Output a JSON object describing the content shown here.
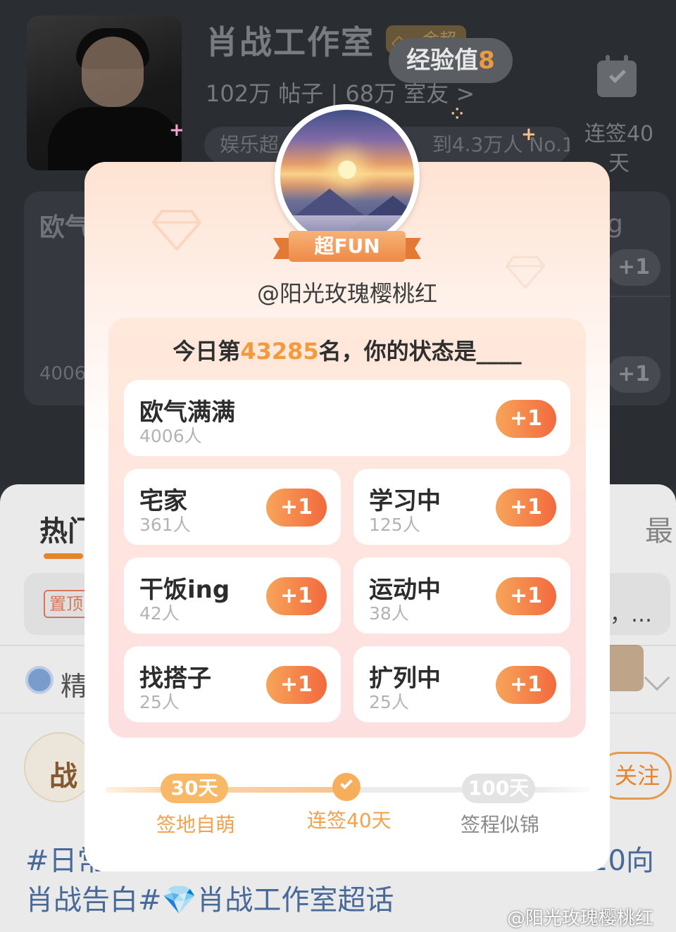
{
  "background": {
    "group_name": "肖战工作室",
    "level_badge": "金超",
    "stats_text": "102万 帖子 | 68万 室友 >",
    "rank_pill_left": "娱乐超",
    "rank_pill_right": "到4.3万人 No.1",
    "exp_label": "经验值",
    "exp_value": "8",
    "streak_label": "连签40天",
    "status_bg_label": "欧气",
    "status_bg_count": "4006",
    "status_bg_suffix": "g",
    "plus_label": "+1",
    "tab_hot": "热门",
    "tab_latest": "最",
    "pin_tag": "置顶",
    "pin_more": "，…",
    "featured_label": "精",
    "post_avatar_text": "战",
    "follow_button": "关注",
    "post_line1_left": "#日常",
    "post_line1_right": "20向",
    "post_line2": "肖战告白#💎肖战工作室超话"
  },
  "modal": {
    "badge": "超FUN",
    "username": "@阳光玫瑰樱桃红",
    "rank_prefix": "今日第",
    "rank_number": "43285",
    "rank_suffix": "名，你的状态是____",
    "options": [
      {
        "label": "欧气满满",
        "count": "4006人",
        "button": "+1"
      },
      {
        "label": "宅家",
        "count": "361人",
        "button": "+1"
      },
      {
        "label": "学习中",
        "count": "125人",
        "button": "+1"
      },
      {
        "label": "干饭ing",
        "count": "42人",
        "button": "+1"
      },
      {
        "label": "运动中",
        "count": "38人",
        "button": "+1"
      },
      {
        "label": "找搭子",
        "count": "25人",
        "button": "+1"
      },
      {
        "label": "扩列中",
        "count": "25人",
        "button": "+1"
      }
    ],
    "milestones": [
      {
        "pill": "30天",
        "name": "签地自萌",
        "state": "done"
      },
      {
        "pill": "",
        "name": "连签40天",
        "state": "current"
      },
      {
        "pill": "100天",
        "name": "签程似锦",
        "state": "todo"
      }
    ]
  },
  "watermark": "@阳光玫瑰樱桃红",
  "colors": {
    "accent_orange": "#f39a3c",
    "plus_gradient_start": "#f7a45a",
    "plus_gradient_end": "#f26a3e",
    "topic_blue": "#4c6ea0"
  }
}
